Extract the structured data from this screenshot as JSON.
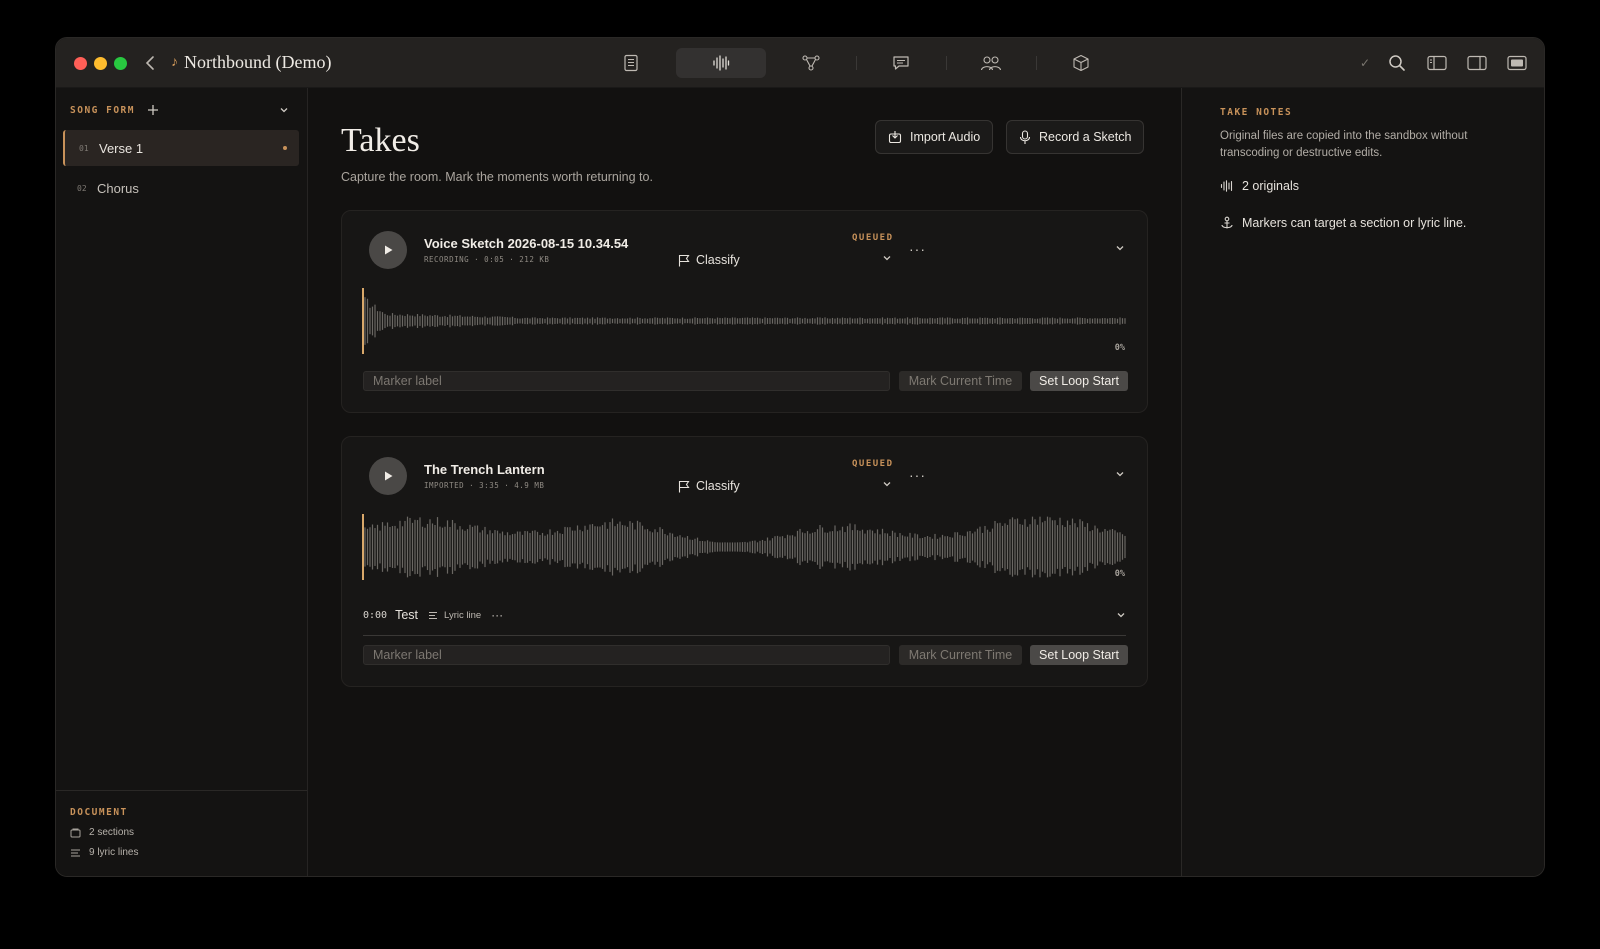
{
  "window": {
    "title": "Northbound (Demo)"
  },
  "toolbar": {
    "center": [
      {
        "name": "lyrics-tab",
        "icon": "document-icon"
      },
      {
        "name": "takes-tab",
        "icon": "waveform-icon",
        "active": true
      },
      {
        "name": "structure-tab",
        "icon": "branch-icon"
      },
      {
        "name": "comments-tab",
        "icon": "chat-icon"
      },
      {
        "name": "collaborators-tab",
        "icon": "people-icon"
      },
      {
        "name": "export-tab",
        "icon": "box-icon"
      }
    ],
    "check_mark": "✓"
  },
  "sidebar": {
    "heading": "SONG FORM",
    "items": [
      {
        "num": "01",
        "label": "Verse 1",
        "active": true
      },
      {
        "num": "02",
        "label": "Chorus",
        "active": false
      }
    ],
    "footer": {
      "heading": "DOCUMENT",
      "sections": "2 sections",
      "lyric_lines": "9 lyric lines"
    }
  },
  "main": {
    "title": "Takes",
    "subtitle": "Capture the room. Mark the moments worth returning to.",
    "import_label": "Import Audio",
    "record_label": "Record a Sketch",
    "takes": [
      {
        "name": "Voice Sketch 2026-08-15 10.34.54",
        "meta": "RECORDING · 0:05 · 212 KB",
        "classify": "Classify",
        "status": "QUEUED",
        "dots": "···",
        "progress": "0%",
        "marker_placeholder": "Marker label",
        "mark_label": "Mark Current Time",
        "loop_label": "Set Loop Start"
      },
      {
        "name": "The Trench Lantern",
        "meta": "IMPORTED · 3:35 · 4.9 MB",
        "classify": "Classify",
        "status": "QUEUED",
        "dots": "···",
        "progress": "0%",
        "marker": {
          "time": "0:00",
          "label": "Test",
          "target": "Lyric line",
          "dots": "···"
        },
        "marker_placeholder": "Marker label",
        "mark_label": "Mark Current Time",
        "loop_label": "Set Loop Start"
      }
    ]
  },
  "inspector": {
    "heading": "TAKE NOTES",
    "description": "Original files are copied into the sandbox without transcoding or destructive edits.",
    "originals": "2 originals",
    "markers_note": "Markers can target a section or lyric line."
  },
  "colors": {
    "accent": "#c8925a",
    "background": "#121110",
    "titlebar": "#242220"
  }
}
